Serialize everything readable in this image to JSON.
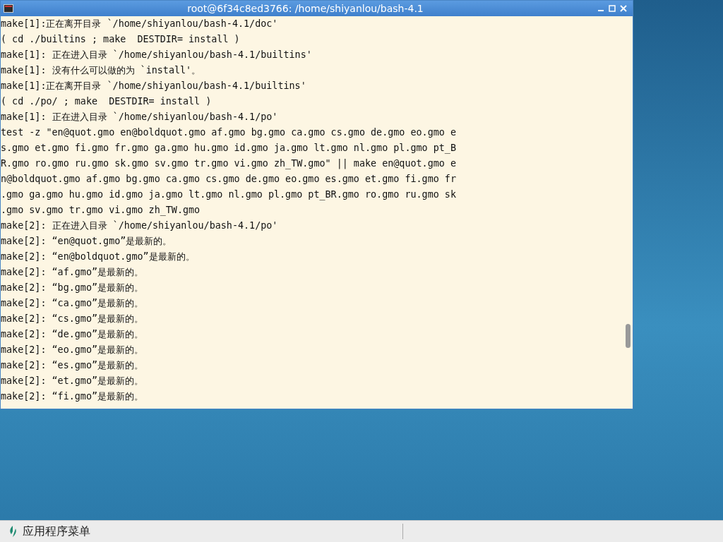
{
  "window": {
    "title": "root@6f34c8ed3766: /home/shiyanlou/bash-4.1"
  },
  "terminal": {
    "lines": [
      "make[1]:正在离开目录 `/home/shiyanlou/bash-4.1/doc'",
      "( cd ./builtins ; make  DESTDIR= install )",
      "make[1]: 正在进入目录 `/home/shiyanlou/bash-4.1/builtins'",
      "make[1]: 没有什么可以做的为 `install'。",
      "make[1]:正在离开目录 `/home/shiyanlou/bash-4.1/builtins'",
      "( cd ./po/ ; make  DESTDIR= install )",
      "make[1]: 正在进入目录 `/home/shiyanlou/bash-4.1/po'",
      "test -z \"en@quot.gmo en@boldquot.gmo af.gmo bg.gmo ca.gmo cs.gmo de.gmo eo.gmo e",
      "s.gmo et.gmo fi.gmo fr.gmo ga.gmo hu.gmo id.gmo ja.gmo lt.gmo nl.gmo pl.gmo pt_B",
      "R.gmo ro.gmo ru.gmo sk.gmo sv.gmo tr.gmo vi.gmo zh_TW.gmo\" || make en@quot.gmo e",
      "n@boldquot.gmo af.gmo bg.gmo ca.gmo cs.gmo de.gmo eo.gmo es.gmo et.gmo fi.gmo fr",
      ".gmo ga.gmo hu.gmo id.gmo ja.gmo lt.gmo nl.gmo pl.gmo pt_BR.gmo ro.gmo ru.gmo sk",
      ".gmo sv.gmo tr.gmo vi.gmo zh_TW.gmo",
      "make[2]: 正在进入目录 `/home/shiyanlou/bash-4.1/po'",
      "make[2]: “en@quot.gmo”是最新的。",
      "make[2]: “en@boldquot.gmo”是最新的。",
      "make[2]: “af.gmo”是最新的。",
      "make[2]: “bg.gmo”是最新的。",
      "make[2]: “ca.gmo”是最新的。",
      "make[2]: “cs.gmo”是最新的。",
      "make[2]: “de.gmo”是最新的。",
      "make[2]: “eo.gmo”是最新的。",
      "make[2]: “es.gmo”是最新的。",
      "make[2]: “et.gmo”是最新的。",
      "make[2]: “fi.gmo”是最新的。"
    ]
  },
  "taskbar": {
    "menu_label": "应用程序菜单"
  }
}
